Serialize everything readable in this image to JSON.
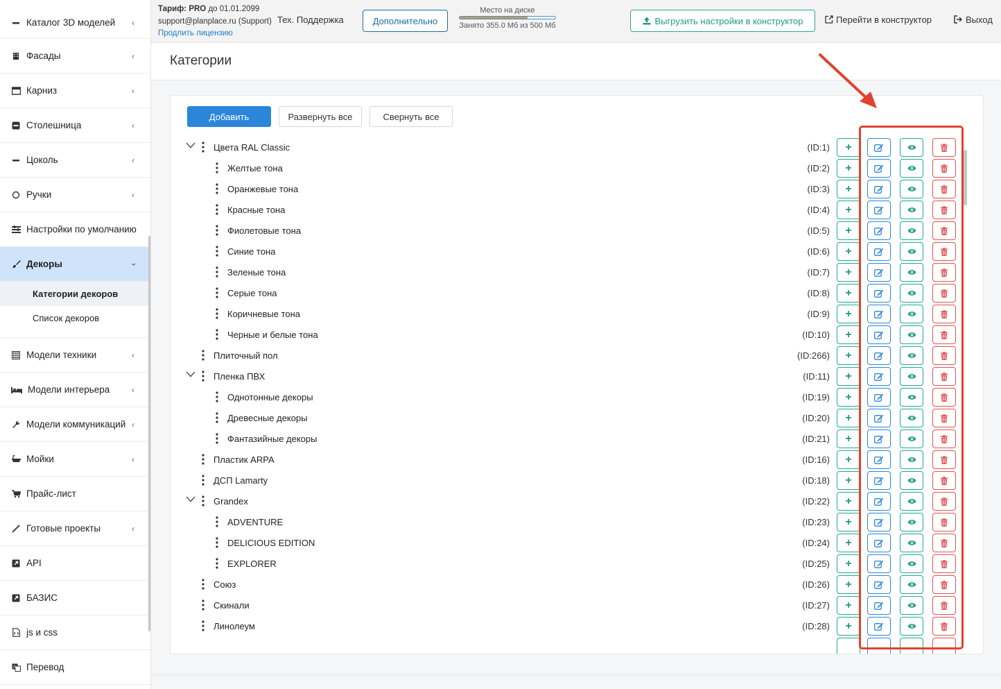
{
  "header": {
    "tariff_label": "Тариф:",
    "tariff_value": "PRO",
    "tariff_until": "до 01.01.2099",
    "support_email": "support@planplace.ru (Support)",
    "renew_link": "Продлить лицензию",
    "tech_support": "Тех. Поддержка",
    "extra_button": "Дополнительно",
    "disk_title": "Место на диске",
    "disk_usage": "Занято 355.0 Мб из 500 Мб",
    "disk_used_fraction": 0.71,
    "upload_button": "Выгрузить настройки в конструктор",
    "constructor_link": "Перейти в конструктор",
    "exit_link": "Выход"
  },
  "sidebar": {
    "items": [
      {
        "label": "Каталог 3D моделей",
        "icon": "minus-icon"
      },
      {
        "label": "Фасады",
        "icon": "building-icon"
      },
      {
        "label": "Карниз",
        "icon": "window-icon"
      },
      {
        "label": "Столешница",
        "icon": "minus-square-icon"
      },
      {
        "label": "Цоколь",
        "icon": "minus-icon"
      },
      {
        "label": "Ручки",
        "icon": "handle-icon"
      },
      {
        "label": "Настройки по умолчанию",
        "icon": "sliders-icon"
      },
      {
        "label": "Декоры",
        "icon": "brush-icon"
      },
      {
        "label": "Модели техники",
        "icon": "calculator-icon"
      },
      {
        "label": "Модели интерьера",
        "icon": "bed-icon"
      },
      {
        "label": "Модели коммуникаций",
        "icon": "wrench-icon"
      },
      {
        "label": "Мойки",
        "icon": "bath-icon"
      },
      {
        "label": "Прайс-лист",
        "icon": "cart-icon"
      },
      {
        "label": "Готовые проекты",
        "icon": "magic-icon"
      },
      {
        "label": "API",
        "icon": "external-icon"
      },
      {
        "label": "БАЗИС",
        "icon": "external-icon"
      },
      {
        "label": "js и css",
        "icon": "code-file-icon"
      },
      {
        "label": "Перевод",
        "icon": "translate-icon"
      }
    ],
    "submenu": [
      "Категории декоров",
      "Список декоров"
    ]
  },
  "page": {
    "title": "Категории",
    "add_button": "Добавить",
    "expand_all_button": "Развернуть все",
    "collapse_all_button": "Свернуть все"
  },
  "tree": [
    {
      "name": "Цвета RAL Classic",
      "id": "(ID:1)",
      "level": 0,
      "expanded": true
    },
    {
      "name": "Желтые тона",
      "id": "(ID:2)",
      "level": 1
    },
    {
      "name": "Оранжевые тона",
      "id": "(ID:3)",
      "level": 1
    },
    {
      "name": "Красные тона",
      "id": "(ID:4)",
      "level": 1
    },
    {
      "name": "Фиолетовые тона",
      "id": "(ID:5)",
      "level": 1
    },
    {
      "name": "Синие тона",
      "id": "(ID:6)",
      "level": 1
    },
    {
      "name": "Зеленые тона",
      "id": "(ID:7)",
      "level": 1
    },
    {
      "name": "Серые тона",
      "id": "(ID:8)",
      "level": 1
    },
    {
      "name": "Коричневые тона",
      "id": "(ID:9)",
      "level": 1
    },
    {
      "name": "Черные и белые тона",
      "id": "(ID:10)",
      "level": 1
    },
    {
      "name": "Плиточный пол",
      "id": "(ID:266)",
      "level": 0
    },
    {
      "name": "Пленка ПВХ",
      "id": "(ID:11)",
      "level": 0,
      "expanded": true
    },
    {
      "name": "Однотонные декоры",
      "id": "(ID:19)",
      "level": 1
    },
    {
      "name": "Древесные декоры",
      "id": "(ID:20)",
      "level": 1
    },
    {
      "name": "Фантазийные декоры",
      "id": "(ID:21)",
      "level": 1
    },
    {
      "name": "Пластик ARPA",
      "id": "(ID:16)",
      "level": 0
    },
    {
      "name": "ДСП Lamarty",
      "id": "(ID:18)",
      "level": 0
    },
    {
      "name": "Grandex",
      "id": "(ID:22)",
      "level": 0,
      "expanded": true
    },
    {
      "name": "ADVENTURE",
      "id": "(ID:23)",
      "level": 1
    },
    {
      "name": "DELICIOUS EDITION",
      "id": "(ID:24)",
      "level": 1
    },
    {
      "name": "EXPLORER",
      "id": "(ID:25)",
      "level": 1
    },
    {
      "name": "Союз",
      "id": "(ID:26)",
      "level": 0
    },
    {
      "name": "Скинали",
      "id": "(ID:27)",
      "level": 0
    },
    {
      "name": "Линолеум",
      "id": "(ID:28)",
      "level": 0
    }
  ],
  "colors": {
    "primary": "#2b86d9",
    "teal": "#26a69a",
    "danger": "#e05353",
    "highlight": "#e0432f",
    "active_bg": "#cfe4fb"
  }
}
